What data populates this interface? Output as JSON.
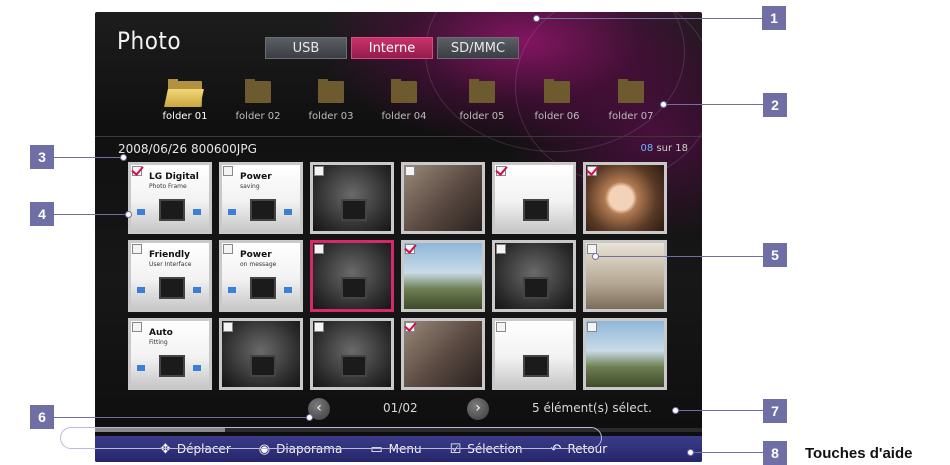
{
  "app": {
    "title": "Photo"
  },
  "sources": [
    {
      "label": "USB",
      "active": false
    },
    {
      "label": "Interne",
      "active": true
    },
    {
      "label": "SD/MMC",
      "active": false
    }
  ],
  "folders": [
    {
      "label": "folder 01",
      "active": true
    },
    {
      "label": "folder 02",
      "active": false
    },
    {
      "label": "folder 03",
      "active": false
    },
    {
      "label": "folder 04",
      "active": false
    },
    {
      "label": "folder 05",
      "active": false
    },
    {
      "label": "folder 06",
      "active": false
    },
    {
      "label": "folder 07",
      "active": false
    }
  ],
  "file_info": "2008/06/26 800600JPG",
  "counter": {
    "current": "08",
    "total_text": "sur 18"
  },
  "thumbnails": [
    {
      "checked": true,
      "style": "white",
      "caption": "LG Digital",
      "sub": "Photo Frame"
    },
    {
      "checked": false,
      "style": "white",
      "caption": "Power",
      "sub": "saving"
    },
    {
      "checked": false,
      "style": "dark",
      "caption": "",
      "sub": ""
    },
    {
      "checked": false,
      "style": "warm",
      "caption": "",
      "sub": ""
    },
    {
      "checked": true,
      "style": "white",
      "caption": "",
      "sub": ""
    },
    {
      "checked": true,
      "style": "face",
      "caption": "",
      "sub": ""
    },
    {
      "checked": false,
      "style": "white",
      "caption": "Friendly",
      "sub": "User Interface"
    },
    {
      "checked": false,
      "style": "white",
      "caption": "Power",
      "sub": "on message"
    },
    {
      "checked": false,
      "style": "dark",
      "caption": "",
      "sub": "",
      "focused": true
    },
    {
      "checked": true,
      "style": "sky",
      "caption": "",
      "sub": ""
    },
    {
      "checked": false,
      "style": "dark",
      "caption": "",
      "sub": ""
    },
    {
      "checked": false,
      "style": "room",
      "caption": "",
      "sub": ""
    },
    {
      "checked": false,
      "style": "white",
      "caption": "Auto",
      "sub": "Fitting"
    },
    {
      "checked": false,
      "style": "dark",
      "caption": "",
      "sub": ""
    },
    {
      "checked": false,
      "style": "dark",
      "caption": "",
      "sub": ""
    },
    {
      "checked": true,
      "style": "warm",
      "caption": "",
      "sub": ""
    },
    {
      "checked": false,
      "style": "white",
      "caption": "",
      "sub": ""
    },
    {
      "checked": false,
      "style": "sky",
      "caption": "",
      "sub": ""
    }
  ],
  "pager": {
    "page": "01/02",
    "prev_icon": "chevron-left-icon",
    "next_icon": "chevron-right-icon"
  },
  "selection_status": "5 élément(s) sélect.",
  "help_bar": [
    {
      "icon": "move-arrows-icon",
      "glyph": "✥",
      "label": "Déplacer"
    },
    {
      "icon": "ok-button-icon",
      "glyph": "◉",
      "label": "Diaporama"
    },
    {
      "icon": "menu-icon",
      "glyph": "▭",
      "label": "Menu"
    },
    {
      "icon": "checkbox-icon",
      "glyph": "☑",
      "label": "Sélection"
    },
    {
      "icon": "return-icon",
      "glyph": "↶",
      "label": "Retour"
    }
  ],
  "callouts": [
    "1",
    "2",
    "3",
    "4",
    "5",
    "6",
    "7",
    "8"
  ],
  "help_caption": "Touches d'aide",
  "colors": {
    "accent": "#d42a6a",
    "callout": "#6f6fa6",
    "helpbar": "#2f3078",
    "counter": "#6fb6ff"
  }
}
